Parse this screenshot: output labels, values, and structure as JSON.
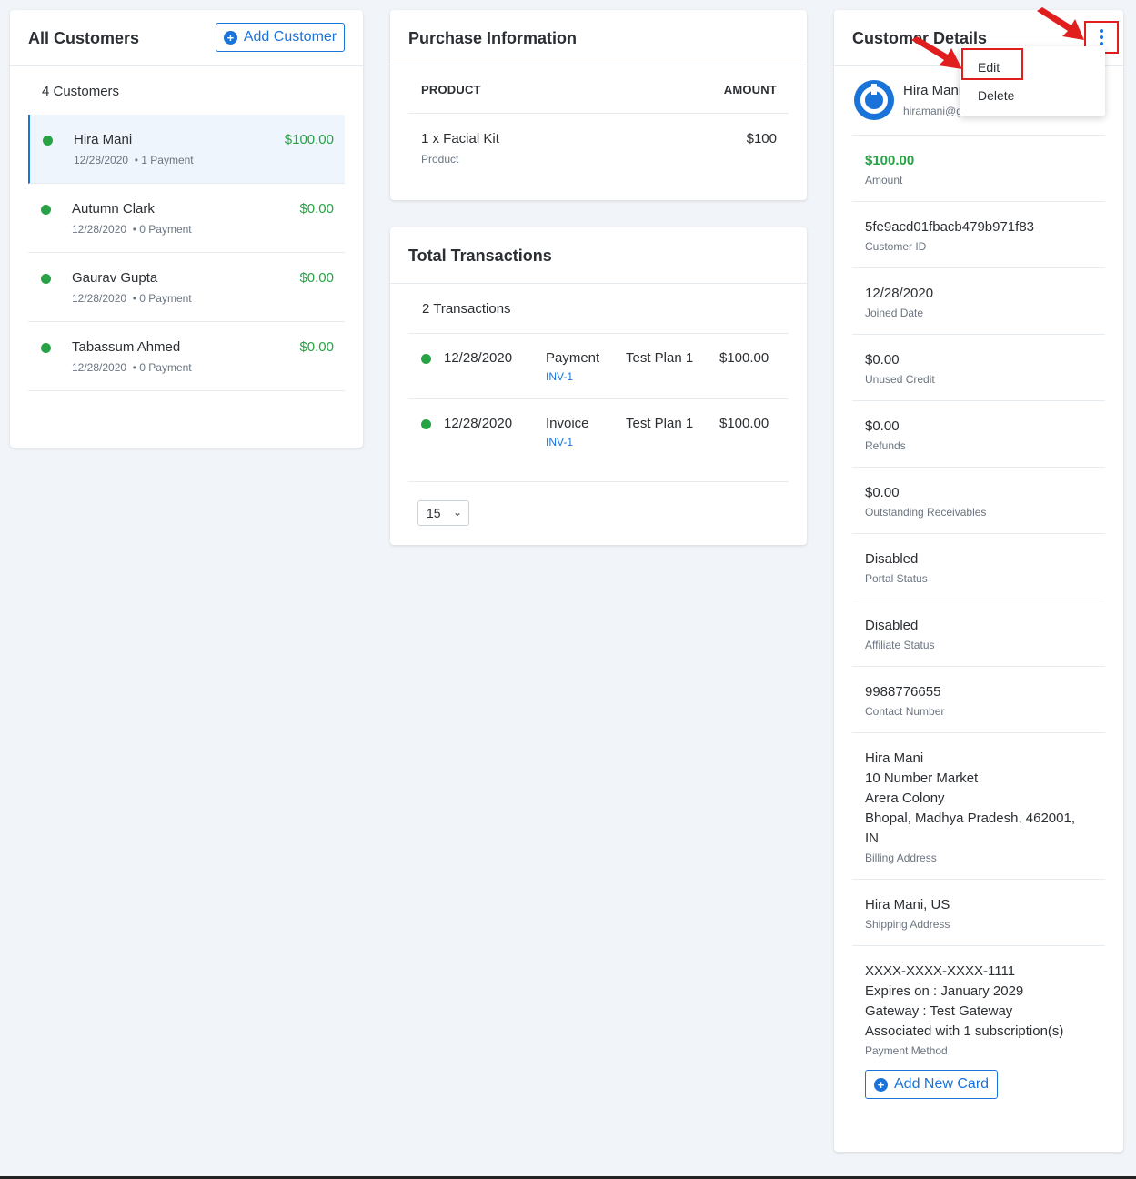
{
  "customers": {
    "title": "All Customers",
    "add_label": "Add Customer",
    "count_label": "4 Customers",
    "items": [
      {
        "name": "Hira Mani",
        "date": "12/28/2020",
        "payments": "• 1 Payment",
        "amount": "$100.00"
      },
      {
        "name": "Autumn Clark",
        "date": "12/28/2020",
        "payments": "• 0 Payment",
        "amount": "$0.00"
      },
      {
        "name": "Gaurav Gupta",
        "date": "12/28/2020",
        "payments": "• 0 Payment",
        "amount": "$0.00"
      },
      {
        "name": "Tabassum Ahmed",
        "date": "12/28/2020",
        "payments": "• 0 Payment",
        "amount": "$0.00"
      }
    ]
  },
  "purchase": {
    "title": "Purchase Information",
    "col_product": "PRODUCT",
    "col_amount": "AMOUNT",
    "item_name": "1 x Facial Kit",
    "item_type": "Product",
    "item_amount": "$100"
  },
  "transactions": {
    "title": "Total Transactions",
    "count_label": "2 Transactions",
    "rows": [
      {
        "date": "12/28/2020",
        "type": "Payment",
        "invoice": "INV-1",
        "plan": "Test Plan 1",
        "amount": "$100.00"
      },
      {
        "date": "12/28/2020",
        "type": "Invoice",
        "invoice": "INV-1",
        "plan": "Test Plan 1",
        "amount": "$100.00"
      }
    ],
    "page_size": "15"
  },
  "details": {
    "title": "Customer Details",
    "name": "Hira Mani",
    "email": "hiramani@g",
    "items": [
      {
        "value": "$100.00",
        "label": "Amount"
      },
      {
        "value": "5fe9acd01fbacb479b971f83",
        "label": "Customer ID"
      },
      {
        "value": "12/28/2020",
        "label": "Joined Date"
      },
      {
        "value": "$0.00",
        "label": "Unused Credit"
      },
      {
        "value": "$0.00",
        "label": "Refunds"
      },
      {
        "value": "$0.00",
        "label": "Outstanding Receivables"
      },
      {
        "value": "Disabled",
        "label": "Portal Status"
      },
      {
        "value": "Disabled",
        "label": "Affiliate Status"
      },
      {
        "value": "9988776655",
        "label": "Contact Number"
      },
      {
        "value": "Hira Mani\n10 Number Market\nArera Colony\nBhopal, Madhya Pradesh, 462001,\nIN",
        "label": "Billing Address"
      },
      {
        "value": "Hira Mani, US",
        "label": "Shipping Address"
      },
      {
        "value": "XXXX-XXXX-XXXX-1111\nExpires on : January 2029\nGateway : Test Gateway\nAssociated with 1 subscription(s)",
        "label": "Payment Method"
      }
    ],
    "add_card_label": "Add New Card"
  },
  "menu": {
    "edit": "Edit",
    "delete": "Delete"
  },
  "colors": {
    "accent": "#1a73d8",
    "positive": "#27a245",
    "highlight": "#e01e1e"
  }
}
